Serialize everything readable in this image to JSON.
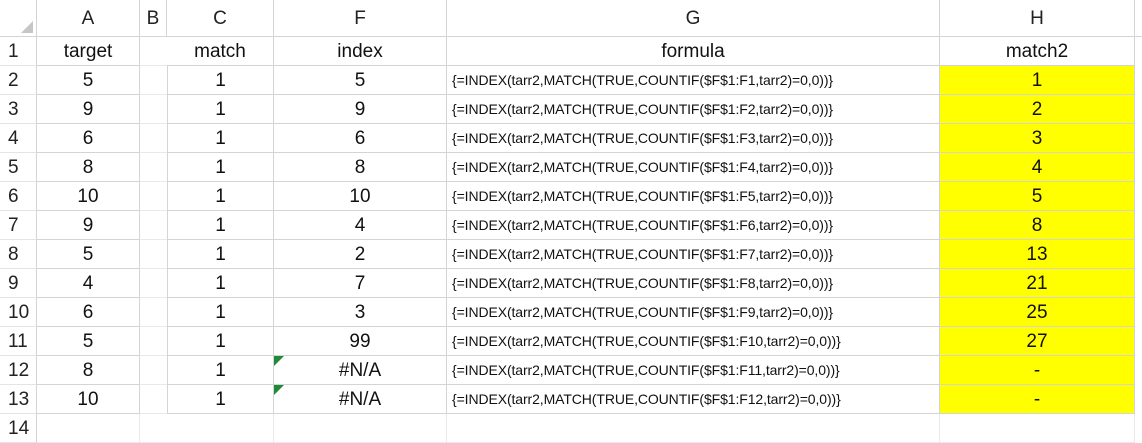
{
  "columns": [
    "A",
    "B",
    "C",
    "F",
    "G",
    "H"
  ],
  "rows": [
    "1",
    "2",
    "3",
    "4",
    "5",
    "6",
    "7",
    "8",
    "9",
    "10",
    "11",
    "12",
    "13",
    "14"
  ],
  "headers": {
    "target": "target",
    "match": "match",
    "index": "index",
    "formula": "formula",
    "match2": "match2"
  },
  "target": [
    "5",
    "9",
    "6",
    "8",
    "10",
    "9",
    "5",
    "4",
    "6",
    "5",
    "8",
    "10"
  ],
  "match": [
    "1",
    "1",
    "1",
    "1",
    "1",
    "1",
    "1",
    "1",
    "1",
    "1",
    "1",
    "1"
  ],
  "index": [
    "5",
    "9",
    "6",
    "8",
    "10",
    "4",
    "2",
    "7",
    "3",
    "99",
    "#N/A",
    "#N/A"
  ],
  "formula": [
    "{=INDEX(tarr2,MATCH(TRUE,COUNTIF($F$1:F1,tarr2)=0,0))}",
    "{=INDEX(tarr2,MATCH(TRUE,COUNTIF($F$1:F2,tarr2)=0,0))}",
    "{=INDEX(tarr2,MATCH(TRUE,COUNTIF($F$1:F3,tarr2)=0,0))}",
    "{=INDEX(tarr2,MATCH(TRUE,COUNTIF($F$1:F4,tarr2)=0,0))}",
    "{=INDEX(tarr2,MATCH(TRUE,COUNTIF($F$1:F5,tarr2)=0,0))}",
    "{=INDEX(tarr2,MATCH(TRUE,COUNTIF($F$1:F6,tarr2)=0,0))}",
    "{=INDEX(tarr2,MATCH(TRUE,COUNTIF($F$1:F7,tarr2)=0,0))}",
    "{=INDEX(tarr2,MATCH(TRUE,COUNTIF($F$1:F8,tarr2)=0,0))}",
    "{=INDEX(tarr2,MATCH(TRUE,COUNTIF($F$1:F9,tarr2)=0,0))}",
    "{=INDEX(tarr2,MATCH(TRUE,COUNTIF($F$1:F10,tarr2)=0,0))}",
    "{=INDEX(tarr2,MATCH(TRUE,COUNTIF($F$1:F11,tarr2)=0,0))}",
    "{=INDEX(tarr2,MATCH(TRUE,COUNTIF($F$1:F12,tarr2)=0,0))}"
  ],
  "match2": [
    "1",
    "2",
    "3",
    "4",
    "5",
    "8",
    "13",
    "21",
    "25",
    "27",
    "-",
    "-"
  ],
  "colors": {
    "highlight": "#ffff00",
    "gridline": "#d4d4d4",
    "error_indicator": "#1e8a3a"
  }
}
